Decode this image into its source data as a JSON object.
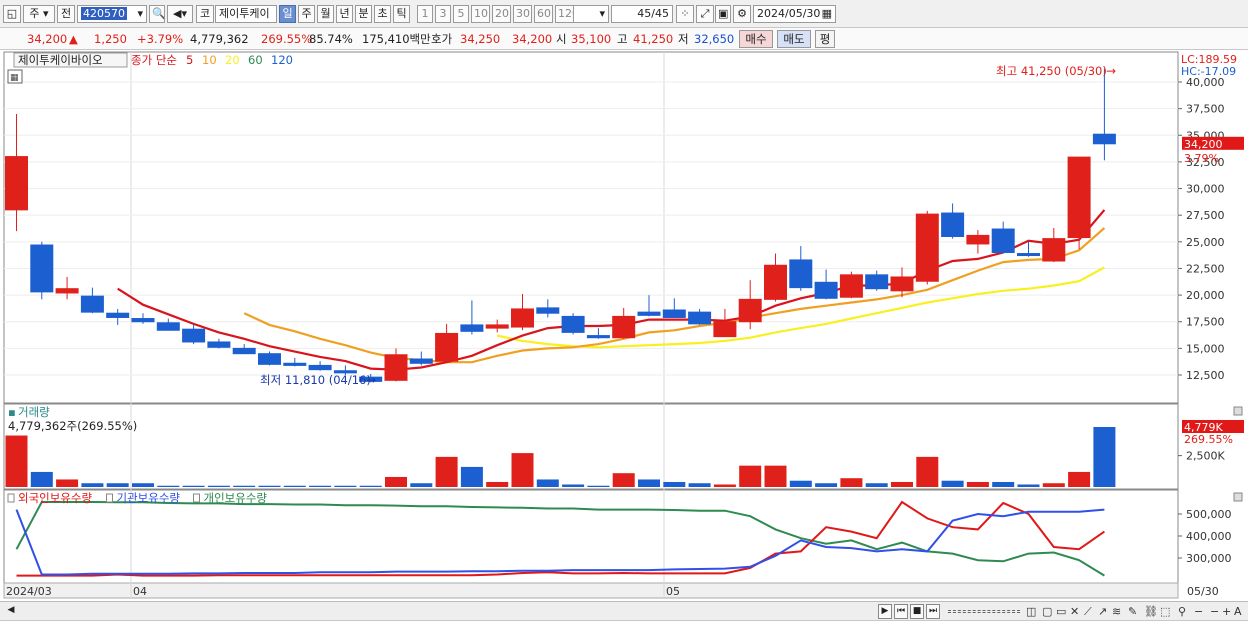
{
  "toolbar": {
    "market": "주",
    "prev": "전",
    "code": "420570",
    "stock_type": "코",
    "stock_name": "제이투케이",
    "periods": [
      "일",
      "주",
      "월",
      "년",
      "분",
      "초",
      "틱"
    ],
    "active_period": "일",
    "intervals": [
      "1",
      "3",
      "5",
      "10",
      "20",
      "30",
      "60",
      "120"
    ],
    "count": "45",
    "count_total": "/45",
    "date": "2024/05/30"
  },
  "quote": {
    "price": "34,200",
    "arrow": "▲",
    "change": "1,250",
    "change_pct": "+3.79%",
    "volume": "4,779,362",
    "volume_ratio": "269.55%",
    "turnover": "85.74%",
    "value": "175,410백만",
    "bid_label": "호가",
    "bid1": "34,250",
    "bid2": "34,200",
    "open_label": "시",
    "open": "35,100",
    "high_label": "고",
    "high": "41,250",
    "low_label": "저",
    "low": "32,650",
    "buy": "매수",
    "sell": "매도",
    "eval": "평"
  },
  "price_panel": {
    "name_tag": "제이투케이바이오",
    "ma_label": "종가 단순",
    "ma_periods": [
      "5",
      "10",
      "20",
      "60",
      "120"
    ],
    "lc": "LC:189.59",
    "hc": "HC:-17.09",
    "high_annot": "최고 41,250 (05/30)",
    "low_annot": "최저 11,810 (04/16)",
    "axis_labels": [
      "40,000",
      "37,500",
      "35,000",
      "32,500",
      "30,000",
      "27,500",
      "25,000",
      "22,500",
      "20,000",
      "17,500",
      "15,000",
      "12,500"
    ],
    "current_tag": "34,200",
    "current_pct": "3.79%"
  },
  "volume_panel": {
    "title": "거래량",
    "info": "4,779,362주(269.55%)",
    "axis_label": "2,500K",
    "current_tag": "4,779K",
    "current_pct": "269.55%"
  },
  "holding_panel": {
    "legend": [
      "외국인보유수량",
      "기관보유수량",
      "개인보유수량"
    ],
    "axis_labels": [
      "500,000",
      "400,000",
      "300,000"
    ]
  },
  "date_axis": {
    "labels": [
      "2024/03",
      "04",
      "05"
    ],
    "right_label": "05/30"
  },
  "colors": {
    "up": "#e0201a",
    "down": "#1c5fd0",
    "ma5": "#d8141c",
    "ma10": "#f0a020",
    "ma20": "#f8f020",
    "foreign": "#e01818",
    "institution": "#3050e8",
    "individual": "#2e8a50"
  },
  "chart_data": {
    "type": "candlestick",
    "candles": [
      {
        "o": 28000,
        "h": 37000,
        "l": 26000,
        "c": 33000
      },
      {
        "o": 24700,
        "h": 25000,
        "l": 19600,
        "c": 20300
      },
      {
        "o": 20200,
        "h": 21700,
        "l": 19600,
        "c": 20600
      },
      {
        "o": 19900,
        "h": 20700,
        "l": 18300,
        "c": 18400
      },
      {
        "o": 18300,
        "h": 18700,
        "l": 17200,
        "c": 17900
      },
      {
        "o": 17800,
        "h": 18300,
        "l": 17300,
        "c": 17500
      },
      {
        "o": 17400,
        "h": 17800,
        "l": 16700,
        "c": 16700
      },
      {
        "o": 16800,
        "h": 17300,
        "l": 15400,
        "c": 15600
      },
      {
        "o": 15600,
        "h": 15900,
        "l": 15000,
        "c": 15100
      },
      {
        "o": 15000,
        "h": 15400,
        "l": 14500,
        "c": 14500
      },
      {
        "o": 14500,
        "h": 14700,
        "l": 13400,
        "c": 13500
      },
      {
        "o": 13600,
        "h": 14100,
        "l": 13300,
        "c": 13400
      },
      {
        "o": 13400,
        "h": 13800,
        "l": 12900,
        "c": 13000
      },
      {
        "o": 12900,
        "h": 13400,
        "l": 12500,
        "c": 12700
      },
      {
        "o": 12300,
        "h": 12600,
        "l": 11810,
        "c": 11900
      },
      {
        "o": 12000,
        "h": 15000,
        "l": 11900,
        "c": 14400
      },
      {
        "o": 14000,
        "h": 14700,
        "l": 13400,
        "c": 13600
      },
      {
        "o": 13800,
        "h": 17300,
        "l": 13600,
        "c": 16400
      },
      {
        "o": 17200,
        "h": 19500,
        "l": 16300,
        "c": 16600
      },
      {
        "o": 16900,
        "h": 17700,
        "l": 16500,
        "c": 17200
      },
      {
        "o": 17000,
        "h": 20100,
        "l": 16700,
        "c": 18700
      },
      {
        "o": 18800,
        "h": 19600,
        "l": 17900,
        "c": 18300
      },
      {
        "o": 18000,
        "h": 18300,
        "l": 16300,
        "c": 16500
      },
      {
        "o": 16200,
        "h": 16900,
        "l": 15900,
        "c": 16000
      },
      {
        "o": 16000,
        "h": 18800,
        "l": 15900,
        "c": 18000
      },
      {
        "o": 18400,
        "h": 20000,
        "l": 18000,
        "c": 18100
      },
      {
        "o": 18600,
        "h": 19700,
        "l": 17900,
        "c": 17900
      },
      {
        "o": 18400,
        "h": 18700,
        "l": 17200,
        "c": 17300
      },
      {
        "o": 16100,
        "h": 18700,
        "l": 16100,
        "c": 17500
      },
      {
        "o": 17500,
        "h": 21400,
        "l": 16800,
        "c": 19600
      },
      {
        "o": 19600,
        "h": 23900,
        "l": 19400,
        "c": 22800
      },
      {
        "o": 23300,
        "h": 24600,
        "l": 20400,
        "c": 20700
      },
      {
        "o": 21200,
        "h": 22400,
        "l": 19600,
        "c": 19700
      },
      {
        "o": 19800,
        "h": 22200,
        "l": 19700,
        "c": 21900
      },
      {
        "o": 21900,
        "h": 22300,
        "l": 20400,
        "c": 20600
      },
      {
        "o": 20400,
        "h": 22600,
        "l": 19800,
        "c": 21700
      },
      {
        "o": 21300,
        "h": 27900,
        "l": 21000,
        "c": 27600
      },
      {
        "o": 27700,
        "h": 28600,
        "l": 25300,
        "c": 25500
      },
      {
        "o": 24800,
        "h": 26100,
        "l": 23900,
        "c": 25600
      },
      {
        "o": 26200,
        "h": 26900,
        "l": 23900,
        "c": 24000
      },
      {
        "o": 23900,
        "h": 25000,
        "l": 23600,
        "c": 23800
      },
      {
        "o": 23200,
        "h": 26300,
        "l": 23100,
        "c": 25300
      },
      {
        "o": 25400,
        "h": 32900,
        "l": 24300,
        "c": 32950
      },
      {
        "o": 35100,
        "h": 41250,
        "l": 32650,
        "c": 34200
      }
    ],
    "ma5": [
      null,
      null,
      null,
      null,
      20600,
      19100,
      18200,
      17300,
      16500,
      15900,
      15200,
      14700,
      14200,
      13800,
      13100,
      13000,
      13200,
      13700,
      14300,
      15300,
      16200,
      16900,
      17100,
      17100,
      17200,
      17700,
      17700,
      17700,
      17600,
      18000,
      19000,
      19700,
      20200,
      20900,
      20900,
      21100,
      22300,
      23200,
      23400,
      24000,
      25100,
      24800,
      25200,
      28000
    ],
    "ma10": [
      null,
      null,
      null,
      null,
      null,
      null,
      null,
      null,
      null,
      18300,
      17200,
      16600,
      15900,
      15300,
      14600,
      14100,
      13900,
      13700,
      13700,
      14300,
      14800,
      15000,
      15100,
      15400,
      15900,
      16500,
      16700,
      17100,
      17400,
      17900,
      18300,
      18700,
      19000,
      19300,
      19600,
      20000,
      20500,
      21400,
      22300,
      23100,
      23300,
      23400,
      24200,
      26300
    ],
    "ma20": [
      null,
      null,
      null,
      null,
      null,
      null,
      null,
      null,
      null,
      null,
      null,
      null,
      null,
      null,
      null,
      null,
      null,
      null,
      null,
      16200,
      15700,
      15400,
      15200,
      15100,
      15200,
      15300,
      15400,
      15500,
      15700,
      16000,
      16500,
      16900,
      17300,
      17800,
      18300,
      18800,
      19300,
      19700,
      20100,
      20400,
      20600,
      20900,
      21300,
      22600
    ],
    "volume": [
      4100,
      1200,
      600,
      300,
      300,
      300,
      100,
      100,
      100,
      100,
      100,
      100,
      100,
      100,
      100,
      800,
      300,
      2400,
      1600,
      400,
      2700,
      600,
      200,
      100,
      1100,
      600,
      400,
      300,
      200,
      1700,
      1700,
      500,
      300,
      700,
      300,
      400,
      2400,
      500,
      400,
      400,
      200,
      300,
      1200,
      4779
    ],
    "foreign": [
      220000,
      220000,
      220000,
      220000,
      225000,
      220000,
      220000,
      220000,
      222000,
      222000,
      222000,
      222000,
      222000,
      222000,
      222000,
      222000,
      222000,
      222000,
      222000,
      225000,
      232000,
      235000,
      230000,
      230000,
      232000,
      230000,
      230000,
      230000,
      230000,
      255000,
      320000,
      330000,
      440000,
      420000,
      390000,
      560000,
      480000,
      440000,
      430000,
      550000,
      500000,
      350000,
      340000,
      420000
    ],
    "institution": [
      520000,
      225000,
      225000,
      228000,
      228000,
      228000,
      228000,
      230000,
      230000,
      232000,
      232000,
      232000,
      235000,
      235000,
      235000,
      238000,
      238000,
      238000,
      240000,
      240000,
      242000,
      242000,
      245000,
      245000,
      245000,
      245000,
      248000,
      250000,
      252000,
      260000,
      310000,
      380000,
      350000,
      345000,
      330000,
      340000,
      330000,
      470000,
      500000,
      490000,
      510000,
      510000,
      510000,
      520000
    ],
    "individual": [
      340000,
      555000,
      555000,
      555000,
      553000,
      553000,
      550000,
      548000,
      548000,
      545000,
      545000,
      543000,
      543000,
      540000,
      540000,
      538000,
      535000,
      535000,
      532000,
      530000,
      528000,
      525000,
      525000,
      520000,
      520000,
      520000,
      518000,
      515000,
      515000,
      490000,
      430000,
      390000,
      365000,
      380000,
      340000,
      370000,
      330000,
      320000,
      290000,
      285000,
      320000,
      325000,
      290000,
      220000
    ]
  }
}
